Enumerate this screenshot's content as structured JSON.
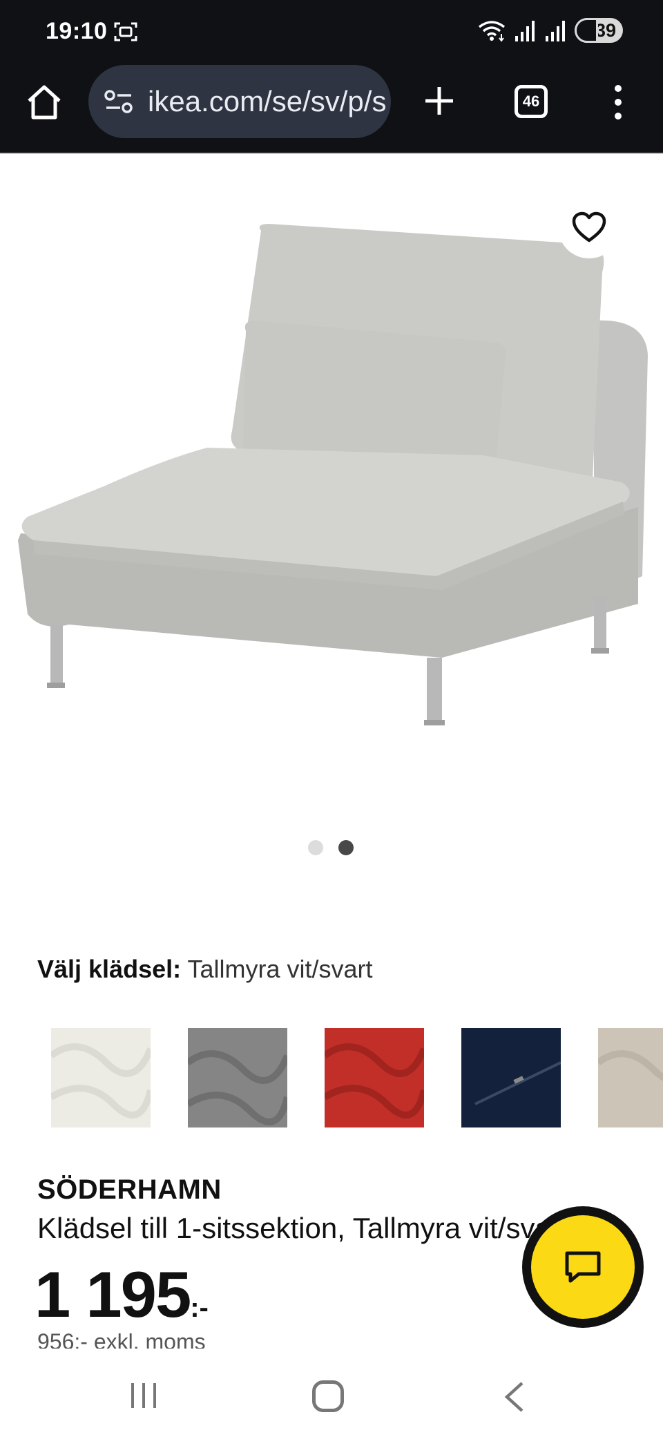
{
  "status_bar": {
    "time": "19:10",
    "battery": "39",
    "icons": [
      "screenshot-icon",
      "wifi-icon",
      "signal-icon",
      "signal-icon",
      "battery-icon"
    ]
  },
  "browser": {
    "url": "ikea.com/se/sv/p/s",
    "tab_count": "46",
    "icons": [
      "home-icon",
      "site-settings-icon",
      "plus-icon",
      "tabs-icon",
      "more-vert-icon"
    ]
  },
  "gallery": {
    "image_count": 2,
    "active_index": 1,
    "favorite_icon": "heart-icon"
  },
  "fabric": {
    "label": "Välj klädsel:",
    "selected": "Tallmyra vit/svart",
    "swatch_colors": [
      "#ecebe4",
      "#858585",
      "#c22f28",
      "#13213d",
      "#cdc4b8"
    ]
  },
  "product": {
    "name": "SÖDERHAMN",
    "description": "Klädsel till 1-sitssektion, Tallmyra vit/svart",
    "price": "1 195",
    "price_suffix": ":-",
    "price_ex_vat": "956:- exkl. moms"
  },
  "colors": {
    "brand_yellow": "#fbd914",
    "browser_bg": "#0f1115",
    "url_box": "#2f3442"
  },
  "nav": {
    "icons": [
      "recent-apps-icon",
      "home-nav-icon",
      "back-icon"
    ]
  }
}
